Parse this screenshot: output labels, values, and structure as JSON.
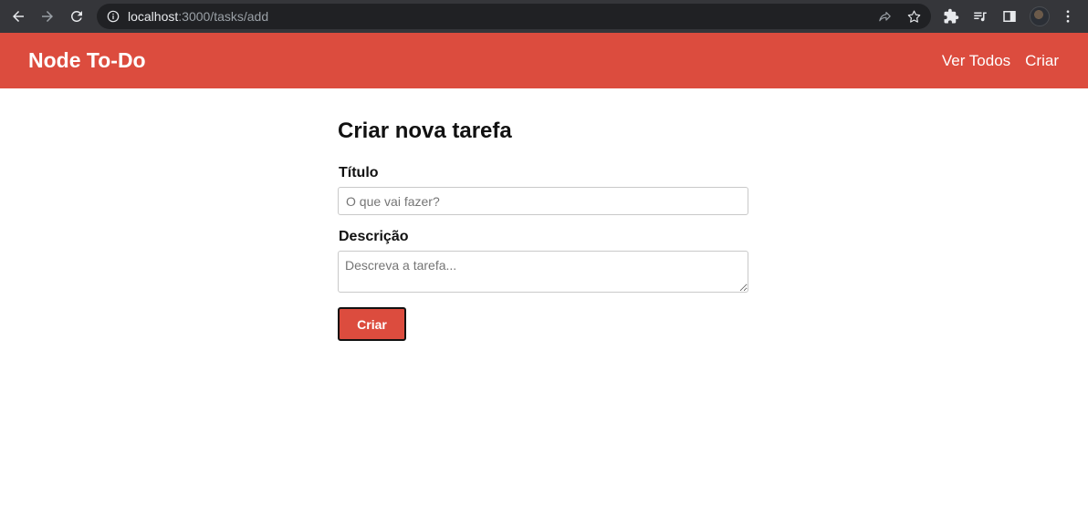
{
  "browser": {
    "url_host": "localhost",
    "url_path": ":3000/tasks/add",
    "icons": {
      "back": "arrow-left-icon",
      "forward": "arrow-right-icon",
      "reload": "reload-icon",
      "info": "info-icon",
      "share": "share-icon",
      "bookmark": "star-icon",
      "extensions": "puzzle-icon",
      "media": "media-queue-icon",
      "side_panel": "side-panel-icon",
      "menu": "kebab-menu-icon"
    }
  },
  "nav": {
    "brand": "Node To-Do",
    "links": [
      "Ver Todos",
      "Criar"
    ],
    "background": "#dc4c3e"
  },
  "form": {
    "title": "Criar nova tarefa",
    "title_label": "Título",
    "title_placeholder": "O que vai fazer?",
    "title_value": "",
    "description_label": "Descrição",
    "description_placeholder": "Descreva a tarefa...",
    "description_value": "",
    "submit_label": "Criar"
  }
}
